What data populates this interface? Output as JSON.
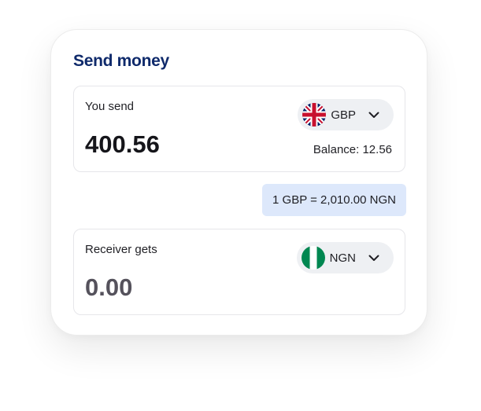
{
  "title": "Send money",
  "send": {
    "label": "You send",
    "amount": "400.56",
    "currency": "GBP",
    "flag_icon": "uk-flag-icon",
    "balance": "Balance: 12.56"
  },
  "rate": "1 GBP = 2,010.00 NGN",
  "receive": {
    "label": "Receiver gets",
    "amount": "0.00",
    "currency": "NGN",
    "flag_icon": "nigeria-flag-icon"
  },
  "colors": {
    "title": "#0f2a6b",
    "rate_bg": "#dde8fb",
    "pill_bg": "#eef0f3",
    "ng_green": "#008751",
    "uk_blue": "#012169",
    "uk_red": "#C8102E"
  }
}
